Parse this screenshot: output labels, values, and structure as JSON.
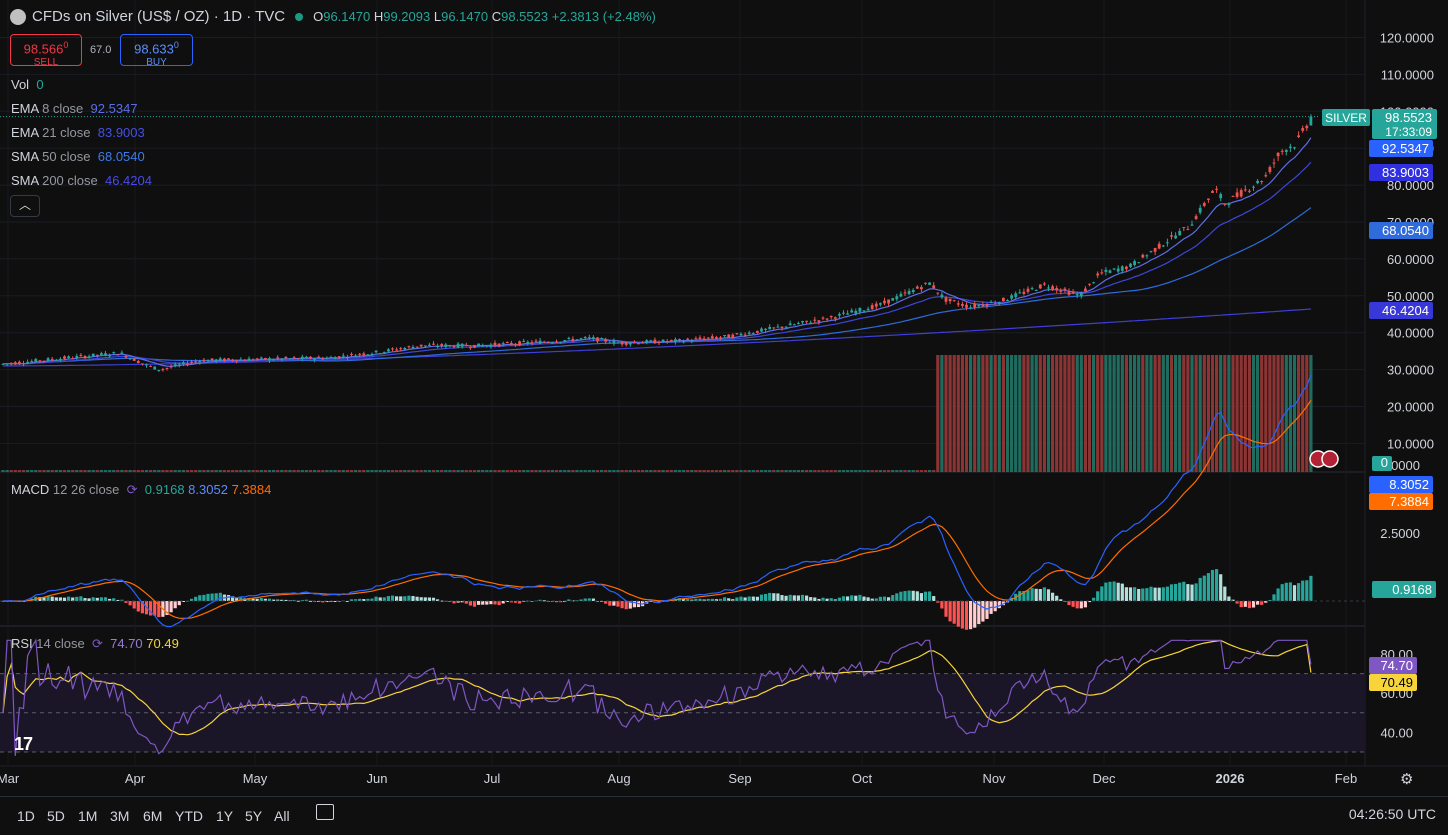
{
  "header": {
    "title": "CFDs on Silver (US$ / OZ) · 1D · TVC",
    "open_label": "O",
    "open": "96.1470",
    "high_label": "H",
    "high": "99.2093",
    "low_label": "L",
    "low": "96.1470",
    "close_label": "C",
    "close": "98.5523",
    "change": "+2.3813 (+2.48%)"
  },
  "trade": {
    "sell_price": "98.566",
    "sell_price_sup": "0",
    "sell_label": "SELL",
    "spread": "67.0",
    "buy_price": "98.633",
    "buy_price_sup": "0",
    "buy_label": "BUY"
  },
  "indicators": {
    "vol": {
      "name": "Vol",
      "value": "0"
    },
    "ema8": {
      "name": "EMA",
      "params": "8 close",
      "value": "92.5347"
    },
    "ema21": {
      "name": "EMA",
      "params": "21 close",
      "value": "83.9003"
    },
    "sma50": {
      "name": "SMA",
      "params": "50 close",
      "value": "68.0540"
    },
    "sma200": {
      "name": "SMA",
      "params": "200 close",
      "value": "46.4204"
    },
    "macd": {
      "name": "MACD",
      "params": "12 26 close",
      "hist": "0.9168",
      "macd": "8.3052",
      "signal": "7.3884"
    },
    "rsi": {
      "name": "RSI",
      "params": "14 close",
      "rsi": "74.70",
      "ma": "70.49"
    }
  },
  "collapse_icon": "chevron-up-icon",
  "axis_tags": {
    "symbol": "SILVER",
    "last_price": "98.5523",
    "countdown": "17:33:09",
    "ema8": "92.5347",
    "ema21": "83.9003",
    "sma50": "68.0540",
    "sma200": "46.4204",
    "vol": "0",
    "macd": "8.3052",
    "signal": "7.3884",
    "hist": "0.9168",
    "rsi": "74.70",
    "rsi_ma": "70.49"
  },
  "colors": {
    "up": "#26a69a",
    "down": "#ef5350",
    "ema8": "#5b6ee8",
    "ema21": "#3d46d8",
    "sma50": "#2f6bdb",
    "sma200": "#3f3fd8",
    "macd": "#2962ff",
    "signal": "#ff6d00",
    "rsi": "#7e57c2",
    "rsi_ma": "#f7d43a"
  },
  "chart_data": {
    "type": "candlestick",
    "price_axis_ticks": [
      "120.0000",
      "110.0000",
      "100.0000",
      "90.0000",
      "80.0000",
      "70.0000",
      "60.0000",
      "50.0000",
      "40.0000",
      "30.0000",
      "20.0000",
      "10.0000"
    ],
    "macd_axis_ticks": [
      "5.0000",
      "2.5000"
    ],
    "rsi_axis_ticks": [
      "80.00",
      "60.00",
      "40.00"
    ],
    "time_axis": [
      "Mar",
      "Apr",
      "May",
      "Jun",
      "Jul",
      "Aug",
      "Sep",
      "Oct",
      "Nov",
      "Dec",
      "2026",
      "Feb"
    ],
    "ylim": [
      0,
      125
    ],
    "series_close_approx": [
      {
        "month": "Mar",
        "close": 31.5
      },
      {
        "month": "Apr",
        "close": 32.5
      },
      {
        "month": "Apr",
        "close": 29.8
      },
      {
        "month": "May",
        "close": 32.5
      },
      {
        "month": "Jun",
        "close": 36.0
      },
      {
        "month": "Jul",
        "close": 36.8
      },
      {
        "month": "Aug",
        "close": 37.8
      },
      {
        "month": "Sep",
        "close": 42.0
      },
      {
        "month": "Oct",
        "close": 48.0
      },
      {
        "month": "Oct",
        "close": 53.5
      },
      {
        "month": "Nov",
        "close": 48.5
      },
      {
        "month": "Dec",
        "close": 58.0
      },
      {
        "month": "Dec",
        "close": 75.0
      },
      {
        "month": "2026",
        "close": 75.5
      },
      {
        "month": "Feb",
        "close": 98.55
      }
    ],
    "macd_hist_last": 0.9168,
    "macd_last": 8.3052,
    "signal_last": 7.3884,
    "rsi_last": 74.7,
    "rsi_ma_last": 70.49
  },
  "range_buttons": [
    "1D",
    "5D",
    "1M",
    "3M",
    "6M",
    "YTD",
    "1Y",
    "5Y",
    "All"
  ],
  "clock": "04:26:50 UTC",
  "logo_text": "17"
}
